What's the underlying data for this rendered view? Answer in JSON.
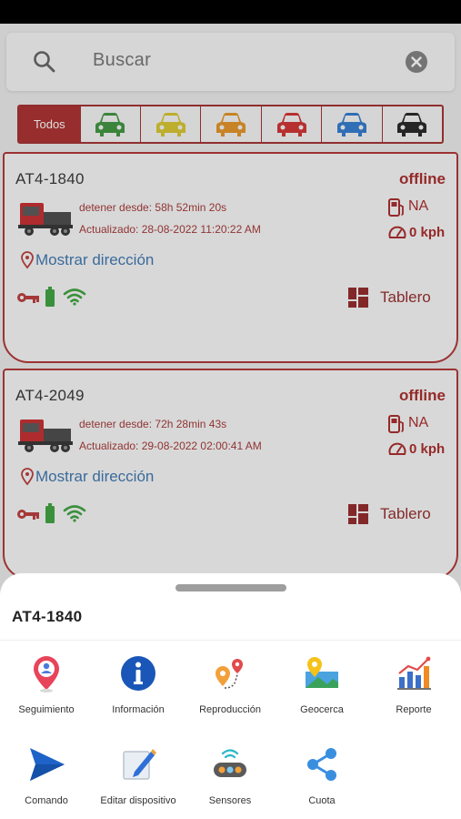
{
  "search": {
    "placeholder": "Buscar",
    "icon": "search-icon",
    "clear_icon": "clear-circle-icon"
  },
  "filters": {
    "all_label": "Todos",
    "cars": [
      {
        "icon": "car-icon",
        "color": "#2e8b2e"
      },
      {
        "icon": "car-icon",
        "color": "#d4c01c"
      },
      {
        "icon": "car-icon",
        "color": "#e08a12"
      },
      {
        "icon": "car-icon",
        "color": "#cc1f1f"
      },
      {
        "icon": "car-icon",
        "color": "#1f6fc9"
      },
      {
        "icon": "car-icon",
        "color": "#111111"
      }
    ]
  },
  "devices": [
    {
      "name": "AT4-1840",
      "status": "offline",
      "stopped": "detener desde: 58h 52min 20s",
      "updated": "Actualizado: 28-08-2022 11:20:22 AM",
      "fuel": "NA",
      "speed": "0 kph",
      "address_link": "Mostrar dirección",
      "dashboard_label": "Tablero"
    },
    {
      "name": "AT4-2049",
      "status": "offline",
      "stopped": "detener desde: 72h 28min 43s",
      "updated": "Actualizado: 29-08-2022 02:00:41 AM",
      "fuel": "NA",
      "speed": "0 kph",
      "address_link": "Mostrar dirección",
      "dashboard_label": "Tablero"
    }
  ],
  "sheet": {
    "title": "AT4-1840",
    "actions": [
      {
        "label": "Seguimiento",
        "icon": "tracking-pin-icon"
      },
      {
        "label": "Información",
        "icon": "info-icon"
      },
      {
        "label": "Reproducción",
        "icon": "playback-route-icon"
      },
      {
        "label": "Geocerca",
        "icon": "geofence-map-icon"
      },
      {
        "label": "Reporte",
        "icon": "report-chart-icon"
      },
      {
        "label": "Comando",
        "icon": "send-command-icon"
      },
      {
        "label": "Editar dispositivo",
        "icon": "edit-device-icon"
      },
      {
        "label": "Sensores",
        "icon": "sensors-icon"
      },
      {
        "label": "Cuota",
        "icon": "share-icon"
      }
    ]
  },
  "colors": {
    "brand_red": "#a31b1b",
    "link_blue": "#2c6aa8"
  }
}
